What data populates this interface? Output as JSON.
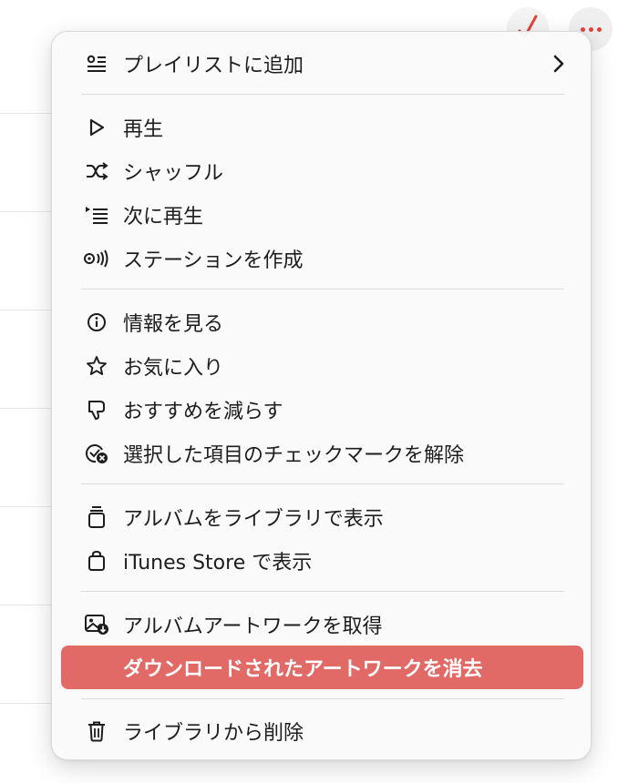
{
  "menu": {
    "items": [
      {
        "label": "プレイリストに追加",
        "icon": "playlist-add-icon",
        "submenu": true
      },
      {
        "label": "再生",
        "icon": "play-icon"
      },
      {
        "label": "シャッフル",
        "icon": "shuffle-icon"
      },
      {
        "label": "次に再生",
        "icon": "play-next-icon"
      },
      {
        "label": "ステーションを作成",
        "icon": "station-icon"
      },
      {
        "label": "情報を見る",
        "icon": "info-icon"
      },
      {
        "label": "お気に入り",
        "icon": "star-icon"
      },
      {
        "label": "おすすめを減らす",
        "icon": "thumbs-down-icon"
      },
      {
        "label": "選択した項目のチェックマークを解除",
        "icon": "uncheck-icon"
      },
      {
        "label": "アルバムをライブラリで表示",
        "icon": "album-library-icon"
      },
      {
        "label": "iTunes Store で表示",
        "icon": "store-bag-icon"
      },
      {
        "label": "アルバムアートワークを取得",
        "icon": "artwork-download-icon"
      },
      {
        "label": "ダウンロードされたアートワークを消去",
        "icon": "",
        "highlighted": true
      },
      {
        "label": "ライブラリから削除",
        "icon": "trash-icon"
      }
    ]
  },
  "colors": {
    "highlight": "#e16a66",
    "accent": "#e0443c",
    "text": "#1d1d1f"
  }
}
